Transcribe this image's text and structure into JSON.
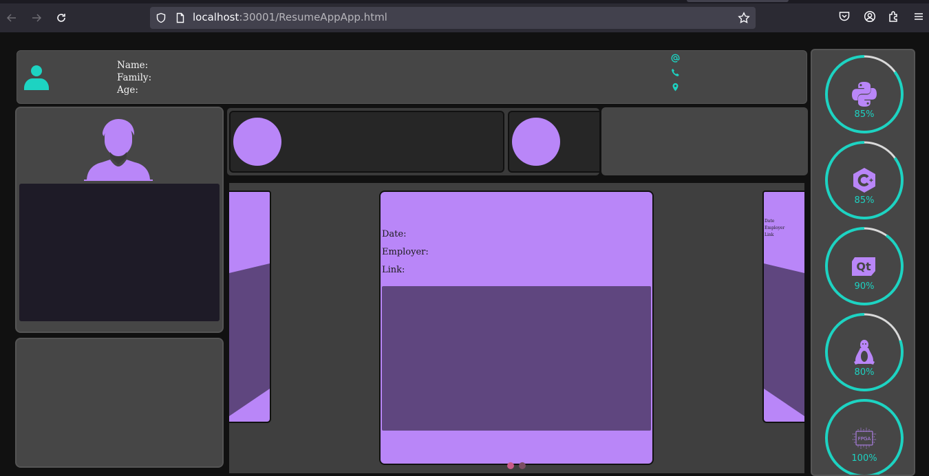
{
  "browser": {
    "url_host": "localhost",
    "url_rest": ":30001/ResumeAppApp.html"
  },
  "header": {
    "name_label": "Name:",
    "family_label": "Family:",
    "age_label": "Age:"
  },
  "carousel": {
    "card": {
      "date_label": "Date:",
      "employer_label": "Employer:",
      "link_label": "Link:"
    },
    "side_card": {
      "date_label": "Date",
      "employer_label": "Employer",
      "link_label": "Link"
    },
    "active_page": 1,
    "page_count": 2
  },
  "skills": [
    {
      "name": "python-icon",
      "percent": 85,
      "label": "85%"
    },
    {
      "name": "cplusplus-icon",
      "percent": 85,
      "label": "85%"
    },
    {
      "name": "qt-icon",
      "percent": 90,
      "label": "90%"
    },
    {
      "name": "linux-icon",
      "percent": 80,
      "label": "80%"
    },
    {
      "name": "fpga-icon",
      "percent": 100,
      "label": "100%",
      "icon_text": "FPGA"
    }
  ],
  "colors": {
    "accent_teal": "#1dd3c2",
    "accent_purple": "#b986f8",
    "dark_purple": "#5f467f",
    "panel": "#464646"
  }
}
